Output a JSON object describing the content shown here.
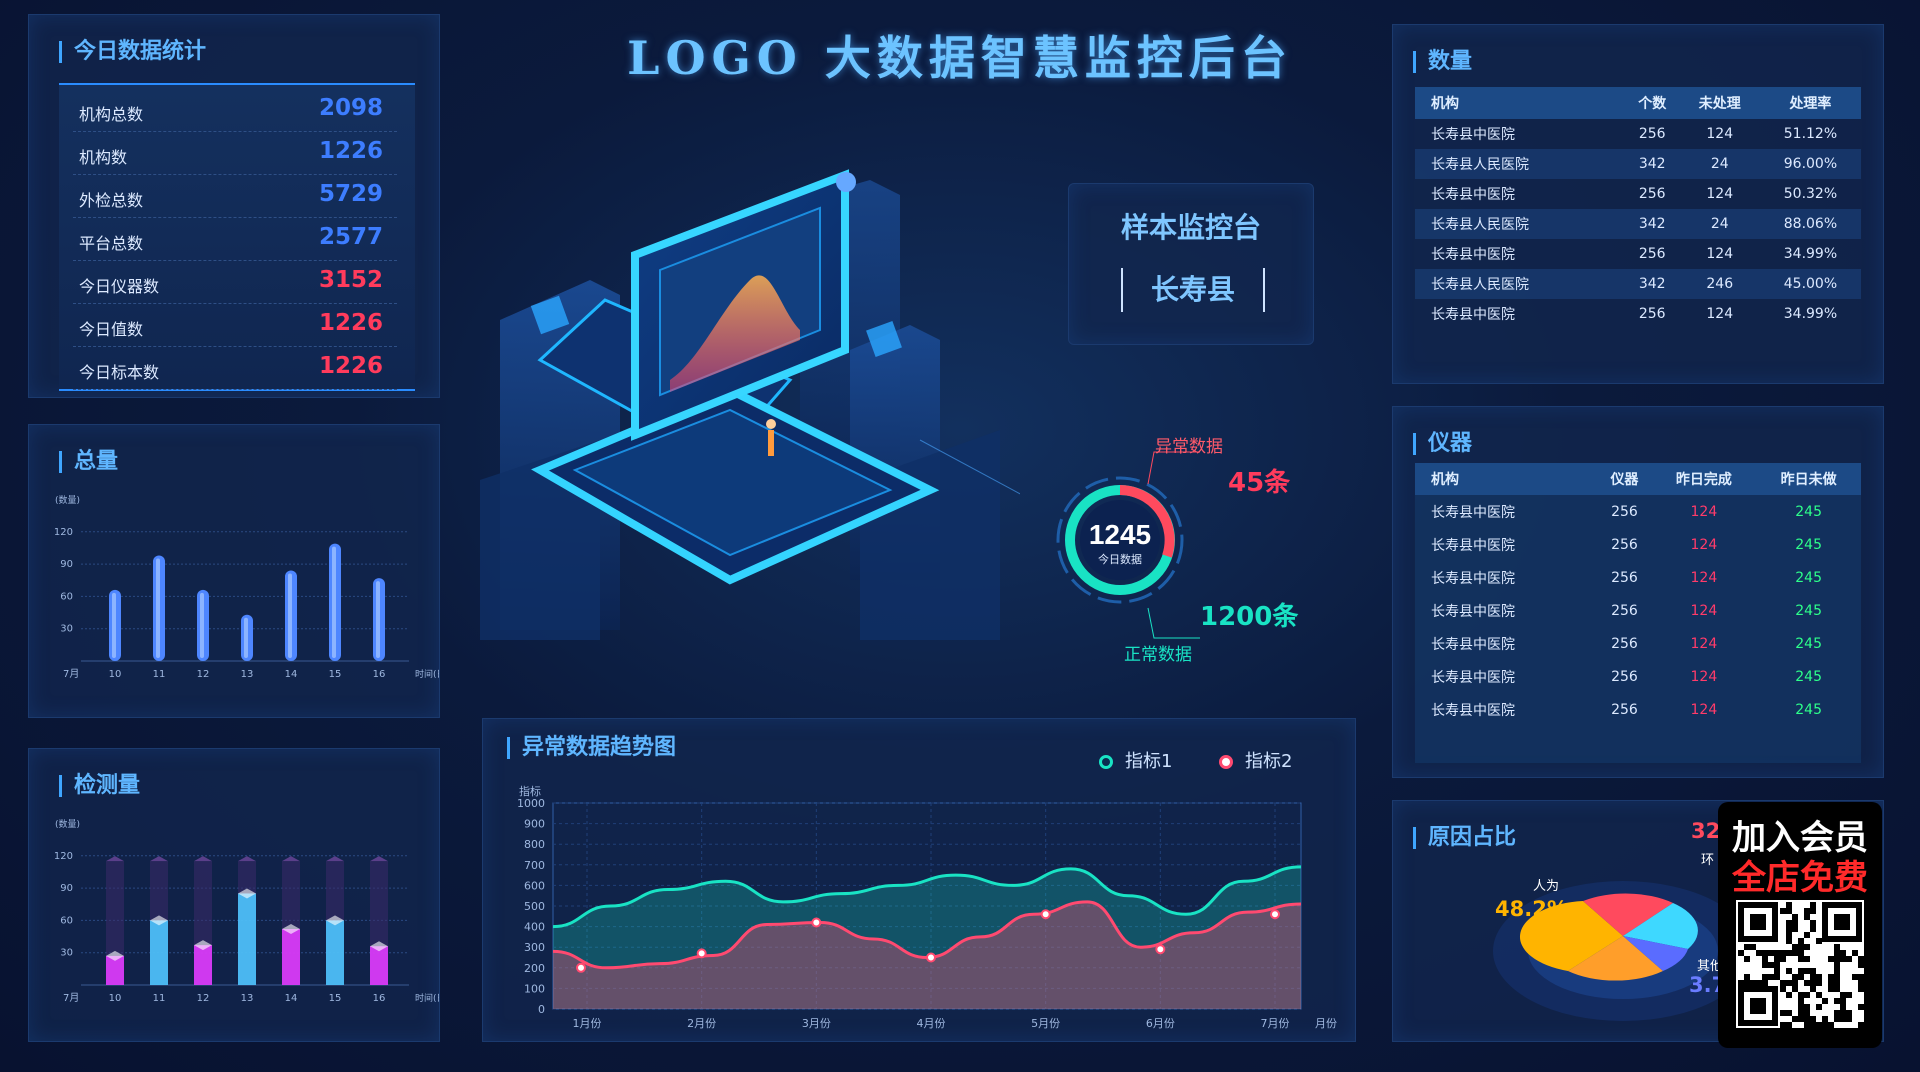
{
  "header": {
    "title": "LOGO 大数据智慧监控后台"
  },
  "stats": {
    "title": "今日数据统计",
    "rows": [
      {
        "label": "机构总数",
        "value": "2098",
        "color": "#3d7dff"
      },
      {
        "label": "机构数",
        "value": "1226",
        "color": "#3d7dff"
      },
      {
        "label": "外检总数",
        "value": "5729",
        "color": "#3d7dff"
      },
      {
        "label": "平台总数",
        "value": "2577",
        "color": "#3d7dff"
      },
      {
        "label": "今日仪器数",
        "value": "3152",
        "color": "#ff3b5c"
      },
      {
        "label": "今日值数",
        "value": "1226",
        "color": "#ff3b5c"
      },
      {
        "label": "今日标本数",
        "value": "1226",
        "color": "#ff3b5c"
      }
    ]
  },
  "total": {
    "title": "总量",
    "unit": "(数量)",
    "xunit": "时间(日)",
    "month": "7月",
    "chart_data": {
      "type": "bar",
      "categories": [
        "10",
        "11",
        "12",
        "13",
        "14",
        "15",
        "16"
      ],
      "values": [
        66,
        98,
        66,
        43,
        84,
        109,
        77
      ],
      "ylim": [
        0,
        130
      ],
      "yticks": [
        30,
        60,
        90,
        120
      ]
    }
  },
  "detect": {
    "title": "检测量",
    "unit": "(数量)",
    "xunit": "时间(日)",
    "month": "7月",
    "chart_data": {
      "type": "bar",
      "categories": [
        "10",
        "11",
        "12",
        "13",
        "14",
        "15",
        "16"
      ],
      "values": [
        27,
        60,
        37,
        85,
        52,
        60,
        36
      ],
      "max": [
        115,
        115,
        115,
        115,
        115,
        115,
        115
      ],
      "ylim": [
        0,
        130
      ],
      "yticks": [
        30,
        60,
        90,
        120
      ]
    }
  },
  "monitor": {
    "title": "样本监控台",
    "county": "长寿县",
    "ring": {
      "total": "1245",
      "total_label": "今日数据",
      "abnormal_label": "异常数据",
      "abnormal_value": "45条",
      "normal_label": "正常数据",
      "normal_value": "1200条",
      "abnormal_color": "#ff4a5e",
      "normal_color": "#19e3c4"
    }
  },
  "trend": {
    "title": "异常数据趋势图",
    "ylabel": "指标",
    "xunit": "月份",
    "legend": [
      {
        "name": "指标1",
        "color": "#19e3c4"
      },
      {
        "name": "指标2",
        "color": "#ff4a70"
      }
    ],
    "chart_data": {
      "type": "area",
      "x": [
        "1月份",
        "2月份",
        "3月份",
        "4月份",
        "5月份",
        "6月份",
        "7月份"
      ],
      "yticks": [
        0,
        100,
        200,
        300,
        400,
        500,
        600,
        700,
        800,
        900,
        1000
      ],
      "ylim": [
        0,
        1000
      ],
      "series": [
        {
          "name": "指标1",
          "values": [
            400,
            500,
            580,
            620,
            520,
            560,
            600,
            650,
            600,
            680,
            550,
            460,
            620,
            690
          ]
        },
        {
          "name": "指标2",
          "values": [
            280,
            200,
            220,
            260,
            410,
            420,
            340,
            250,
            350,
            460,
            520,
            300,
            370,
            470,
            510
          ]
        }
      ],
      "markers2": [
        200,
        270,
        420,
        250,
        460,
        290,
        460
      ]
    }
  },
  "count": {
    "title": "数量",
    "headers": [
      "机构",
      "个数",
      "未处理",
      "处理率"
    ],
    "rows": [
      [
        "长寿县中医院",
        "256",
        "124",
        "51.12%"
      ],
      [
        "长寿县人民医院",
        "342",
        "24",
        "96.00%"
      ],
      [
        "长寿县中医院",
        "256",
        "124",
        "50.32%"
      ],
      [
        "长寿县人民医院",
        "342",
        "24",
        "88.06%"
      ],
      [
        "长寿县中医院",
        "256",
        "124",
        "34.99%"
      ],
      [
        "长寿县人民医院",
        "342",
        "246",
        "45.00%"
      ],
      [
        "长寿县中医院",
        "256",
        "124",
        "34.99%"
      ]
    ]
  },
  "instrument": {
    "title": "仪器",
    "headers": [
      "机构",
      "仪器",
      "昨日完成",
      "昨日未做"
    ],
    "rows": [
      [
        "长寿县中医院",
        "256",
        "124",
        "245"
      ],
      [
        "长寿县中医院",
        "256",
        "124",
        "245"
      ],
      [
        "长寿县中医院",
        "256",
        "124",
        "245"
      ],
      [
        "长寿县中医院",
        "256",
        "124",
        "245"
      ],
      [
        "长寿县中医院",
        "256",
        "124",
        "245"
      ],
      [
        "长寿县中医院",
        "256",
        "124",
        "245"
      ],
      [
        "长寿县中医院",
        "256",
        "124",
        "245"
      ]
    ],
    "done_color": "#ff3b6a",
    "todo_color": "#2dff8a"
  },
  "reason": {
    "title": "原因占比",
    "labels": {
      "human": "人为",
      "human_pct": "48.2%",
      "env": "环",
      "env_pct": "32.",
      "other": "其他",
      "other_pct": "3.7"
    }
  },
  "promo": {
    "line1": "加入会员",
    "line2": "全店免费"
  }
}
